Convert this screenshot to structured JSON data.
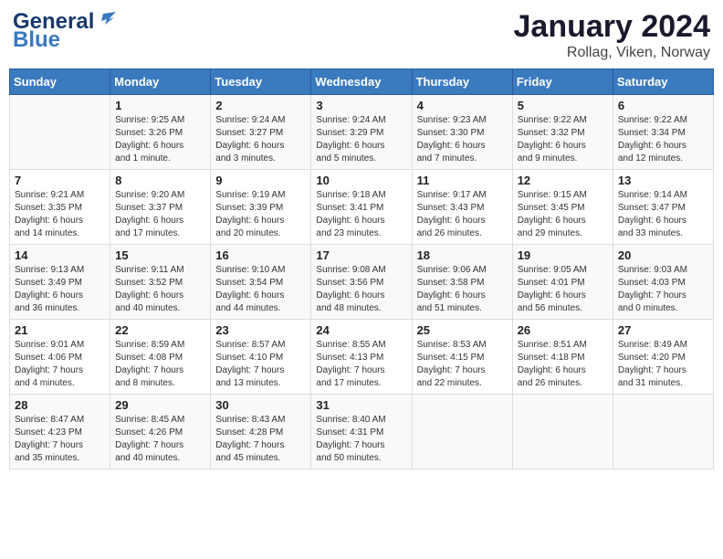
{
  "header": {
    "logo_general": "General",
    "logo_blue": "Blue",
    "title": "January 2024",
    "subtitle": "Rollag, Viken, Norway"
  },
  "days_of_week": [
    "Sunday",
    "Monday",
    "Tuesday",
    "Wednesday",
    "Thursday",
    "Friday",
    "Saturday"
  ],
  "weeks": [
    [
      {
        "day": "",
        "info": ""
      },
      {
        "day": "1",
        "info": "Sunrise: 9:25 AM\nSunset: 3:26 PM\nDaylight: 6 hours\nand 1 minute."
      },
      {
        "day": "2",
        "info": "Sunrise: 9:24 AM\nSunset: 3:27 PM\nDaylight: 6 hours\nand 3 minutes."
      },
      {
        "day": "3",
        "info": "Sunrise: 9:24 AM\nSunset: 3:29 PM\nDaylight: 6 hours\nand 5 minutes."
      },
      {
        "day": "4",
        "info": "Sunrise: 9:23 AM\nSunset: 3:30 PM\nDaylight: 6 hours\nand 7 minutes."
      },
      {
        "day": "5",
        "info": "Sunrise: 9:22 AM\nSunset: 3:32 PM\nDaylight: 6 hours\nand 9 minutes."
      },
      {
        "day": "6",
        "info": "Sunrise: 9:22 AM\nSunset: 3:34 PM\nDaylight: 6 hours\nand 12 minutes."
      }
    ],
    [
      {
        "day": "7",
        "info": "Sunrise: 9:21 AM\nSunset: 3:35 PM\nDaylight: 6 hours\nand 14 minutes."
      },
      {
        "day": "8",
        "info": "Sunrise: 9:20 AM\nSunset: 3:37 PM\nDaylight: 6 hours\nand 17 minutes."
      },
      {
        "day": "9",
        "info": "Sunrise: 9:19 AM\nSunset: 3:39 PM\nDaylight: 6 hours\nand 20 minutes."
      },
      {
        "day": "10",
        "info": "Sunrise: 9:18 AM\nSunset: 3:41 PM\nDaylight: 6 hours\nand 23 minutes."
      },
      {
        "day": "11",
        "info": "Sunrise: 9:17 AM\nSunset: 3:43 PM\nDaylight: 6 hours\nand 26 minutes."
      },
      {
        "day": "12",
        "info": "Sunrise: 9:15 AM\nSunset: 3:45 PM\nDaylight: 6 hours\nand 29 minutes."
      },
      {
        "day": "13",
        "info": "Sunrise: 9:14 AM\nSunset: 3:47 PM\nDaylight: 6 hours\nand 33 minutes."
      }
    ],
    [
      {
        "day": "14",
        "info": "Sunrise: 9:13 AM\nSunset: 3:49 PM\nDaylight: 6 hours\nand 36 minutes."
      },
      {
        "day": "15",
        "info": "Sunrise: 9:11 AM\nSunset: 3:52 PM\nDaylight: 6 hours\nand 40 minutes."
      },
      {
        "day": "16",
        "info": "Sunrise: 9:10 AM\nSunset: 3:54 PM\nDaylight: 6 hours\nand 44 minutes."
      },
      {
        "day": "17",
        "info": "Sunrise: 9:08 AM\nSunset: 3:56 PM\nDaylight: 6 hours\nand 48 minutes."
      },
      {
        "day": "18",
        "info": "Sunrise: 9:06 AM\nSunset: 3:58 PM\nDaylight: 6 hours\nand 51 minutes."
      },
      {
        "day": "19",
        "info": "Sunrise: 9:05 AM\nSunset: 4:01 PM\nDaylight: 6 hours\nand 56 minutes."
      },
      {
        "day": "20",
        "info": "Sunrise: 9:03 AM\nSunset: 4:03 PM\nDaylight: 7 hours\nand 0 minutes."
      }
    ],
    [
      {
        "day": "21",
        "info": "Sunrise: 9:01 AM\nSunset: 4:06 PM\nDaylight: 7 hours\nand 4 minutes."
      },
      {
        "day": "22",
        "info": "Sunrise: 8:59 AM\nSunset: 4:08 PM\nDaylight: 7 hours\nand 8 minutes."
      },
      {
        "day": "23",
        "info": "Sunrise: 8:57 AM\nSunset: 4:10 PM\nDaylight: 7 hours\nand 13 minutes."
      },
      {
        "day": "24",
        "info": "Sunrise: 8:55 AM\nSunset: 4:13 PM\nDaylight: 7 hours\nand 17 minutes."
      },
      {
        "day": "25",
        "info": "Sunrise: 8:53 AM\nSunset: 4:15 PM\nDaylight: 7 hours\nand 22 minutes."
      },
      {
        "day": "26",
        "info": "Sunrise: 8:51 AM\nSunset: 4:18 PM\nDaylight: 6 hours\nand 26 minutes."
      },
      {
        "day": "27",
        "info": "Sunrise: 8:49 AM\nSunset: 4:20 PM\nDaylight: 7 hours\nand 31 minutes."
      }
    ],
    [
      {
        "day": "28",
        "info": "Sunrise: 8:47 AM\nSunset: 4:23 PM\nDaylight: 7 hours\nand 35 minutes."
      },
      {
        "day": "29",
        "info": "Sunrise: 8:45 AM\nSunset: 4:26 PM\nDaylight: 7 hours\nand 40 minutes."
      },
      {
        "day": "30",
        "info": "Sunrise: 8:43 AM\nSunset: 4:28 PM\nDaylight: 7 hours\nand 45 minutes."
      },
      {
        "day": "31",
        "info": "Sunrise: 8:40 AM\nSunset: 4:31 PM\nDaylight: 7 hours\nand 50 minutes."
      },
      {
        "day": "",
        "info": ""
      },
      {
        "day": "",
        "info": ""
      },
      {
        "day": "",
        "info": ""
      }
    ]
  ]
}
